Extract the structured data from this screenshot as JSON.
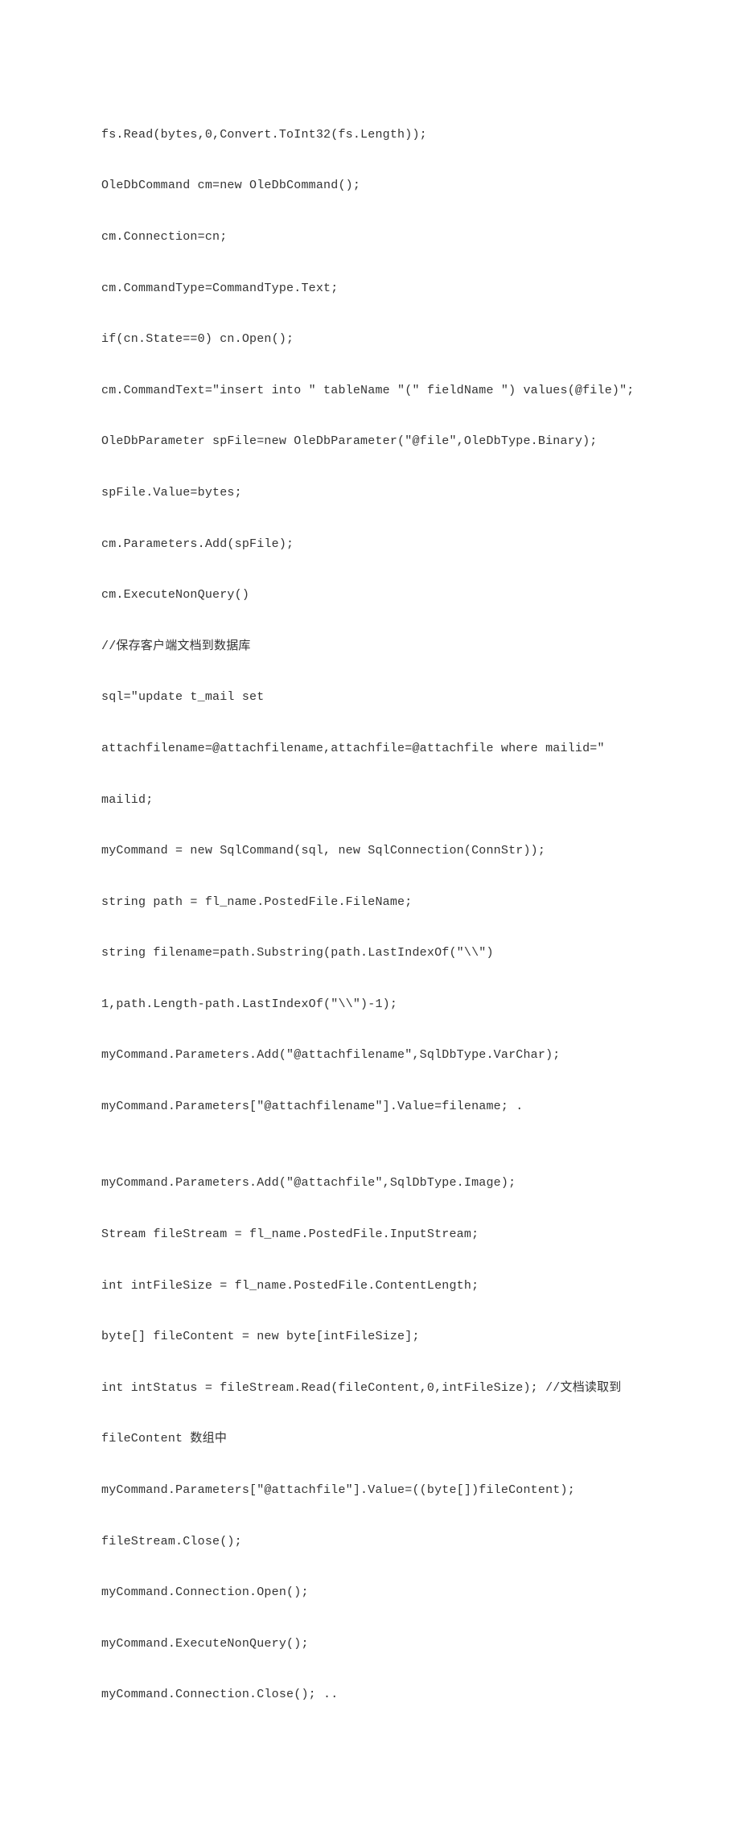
{
  "code": {
    "lines": [
      "fs.Read(bytes,0,Convert.ToInt32(fs.Length));",
      "OleDbCommand cm=new OleDbCommand();",
      "cm.Connection=cn;",
      "cm.CommandType=CommandType.Text;",
      "if(cn.State==0) cn.Open();",
      "cm.CommandText=\"insert into \" tableName \"(\" fieldName \") values(@file)\";",
      "OleDbParameter spFile=new OleDbParameter(\"@file\",OleDbType.Binary);",
      "spFile.Value=bytes;",
      "cm.Parameters.Add(spFile);",
      "cm.ExecuteNonQuery()",
      "//保存客户端文档到数据库",
      "sql=\"update t_mail set",
      "attachfilename=@attachfilename,attachfile=@attachfile where mailid=\"",
      "mailid;",
      "myCommand = new SqlCommand(sql, new SqlConnection(ConnStr));",
      "string path = fl_name.PostedFile.FileName;",
      "string filename=path.Substring(path.LastIndexOf(\"\\\\\")",
      "1,path.Length-path.LastIndexOf(\"\\\\\")-1);",
      "myCommand.Parameters.Add(\"@attachfilename\",SqlDbType.VarChar);",
      "myCommand.Parameters[\"@attachfilename\"].Value=filename; .",
      "",
      "myCommand.Parameters.Add(\"@attachfile\",SqlDbType.Image);",
      "Stream fileStream = fl_name.PostedFile.InputStream;",
      "int intFileSize = fl_name.PostedFile.ContentLength;",
      "byte[] fileContent = new byte[intFileSize];",
      "int intStatus = fileStream.Read(fileContent,0,intFileSize); //文档读取到",
      "fileContent 数组中",
      "myCommand.Parameters[\"@attachfile\"].Value=((byte[])fileContent);",
      "fileStream.Close();",
      "myCommand.Connection.Open();",
      "myCommand.ExecuteNonQuery();",
      "myCommand.Connection.Close(); .."
    ]
  }
}
